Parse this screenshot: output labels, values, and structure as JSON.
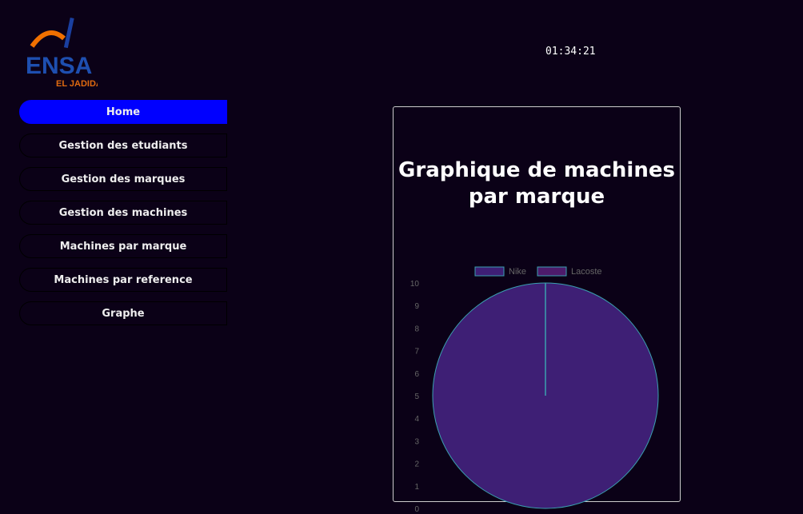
{
  "logo": {
    "text": "ENSA",
    "subtext": "EL JADIDA"
  },
  "nav": [
    {
      "label": "Home",
      "active": true
    },
    {
      "label": "Gestion des etudiants"
    },
    {
      "label": "Gestion des marques"
    },
    {
      "label": "Gestion des machines"
    },
    {
      "label": "Machines par marque"
    },
    {
      "label": "Machines par reference"
    },
    {
      "label": "Graphe"
    }
  ],
  "clock": "01:34:21",
  "chart_data": {
    "type": "pie",
    "title": "Graphique de machines par marque",
    "categories": [
      "Nike",
      "Lacoste"
    ],
    "values": [
      1,
      0
    ],
    "colors": [
      "#3e1f75",
      "#4d1b6b"
    ],
    "border_color": "#3aa0b0",
    "legend": "top",
    "y_ticks": [
      0,
      1,
      2,
      3,
      4,
      5,
      6,
      7,
      8,
      9,
      10
    ]
  }
}
